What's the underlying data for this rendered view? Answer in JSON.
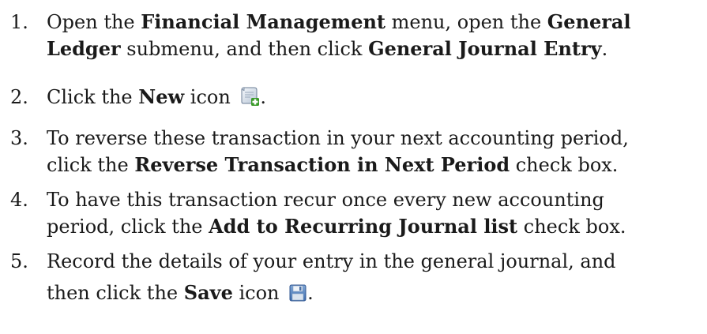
{
  "steps": [
    {
      "number": "1.",
      "line1": {
        "a": "Open the ",
        "b": "Financial Management",
        "c": " menu, open the ",
        "d": "General"
      },
      "line2": {
        "a": "Ledger",
        "b": " submenu, and then click ",
        "c": "General Journal Entry",
        "d": "."
      }
    },
    {
      "number": "2.",
      "line1": {
        "a": "Click the ",
        "b": "New",
        "c": " icon ",
        "d": "."
      },
      "icon": "new-document-icon"
    },
    {
      "number": "3.",
      "line1": {
        "a": "To reverse these transaction in your next accounting period,"
      },
      "line2": {
        "a": "click the ",
        "b": "Reverse Transaction in Next Period",
        "c": " check box."
      }
    },
    {
      "number": "4.",
      "line1": {
        "a": "To have this transaction recur once every new accounting"
      },
      "line2": {
        "a": "period, click the ",
        "b": "Add to Recurring Journal list",
        "c": " check box."
      }
    },
    {
      "number": "5.",
      "line1": {
        "a": "Record the details of your entry in the general journal, and"
      },
      "line2": {
        "a": "then click the ",
        "b": "Save",
        "c": " icon ",
        "d": "."
      },
      "icon": "save-floppy-icon"
    }
  ]
}
